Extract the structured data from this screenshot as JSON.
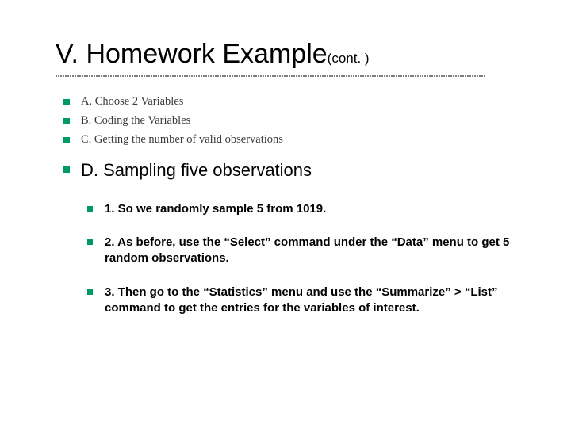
{
  "title": {
    "main": "V. Homework Example",
    "suffix": "(cont. )"
  },
  "bullets": [
    {
      "text": "A. Choose 2 Variables",
      "style": "small"
    },
    {
      "text": "B. Coding the Variables",
      "style": "small"
    },
    {
      "text": "C. Getting the number of valid observations",
      "style": "small"
    },
    {
      "text": "D. Sampling five observations",
      "style": "big"
    }
  ],
  "sub_bullets": [
    {
      "text": "1. So we randomly sample 5 from 1019."
    },
    {
      "text": "2. As before, use the “Select” command under the “Data” menu to get 5 random observations."
    },
    {
      "text": "3. Then go to the “Statistics” menu and use the “Summarize” > “List” command to get the entries for the variables of interest."
    }
  ]
}
